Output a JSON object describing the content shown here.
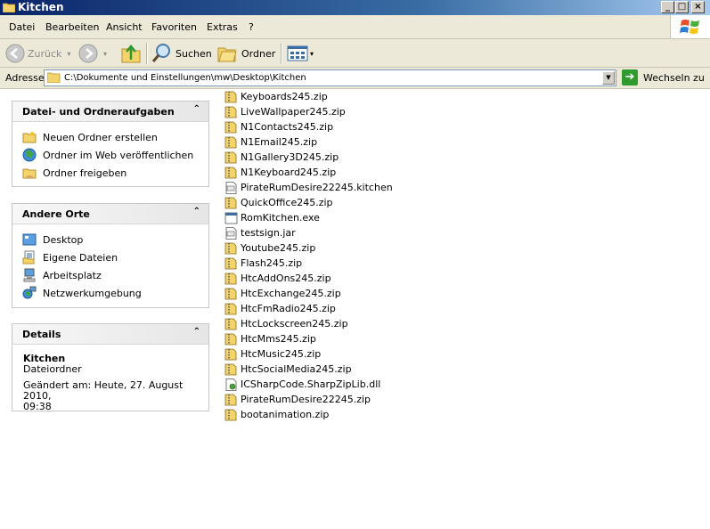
{
  "window": {
    "title": "Kitchen"
  },
  "menu": [
    "Datei",
    "Bearbeiten",
    "Ansicht",
    "Favoriten",
    "Extras",
    "?"
  ],
  "toolbar": {
    "back": "Zurück",
    "search": "Suchen",
    "folders": "Ordner"
  },
  "address": {
    "label": "Adresse",
    "path": "C:\\Dokumente und Einstellungen\\mw\\Desktop\\Kitchen",
    "go": "Wechseln zu"
  },
  "tasks": {
    "title": "Datei- und Ordneraufgaben",
    "items": [
      "Neuen Ordner erstellen",
      "Ordner im Web veröffentlichen",
      "Ordner freigeben"
    ]
  },
  "places": {
    "title": "Andere Orte",
    "items": [
      "Desktop",
      "Eigene Dateien",
      "Arbeitsplatz",
      "Netzwerkumgebung"
    ]
  },
  "details": {
    "title": "Details",
    "name": "Kitchen",
    "type": "Dateiordner",
    "modified": "Geändert am: Heute, 27. August 2010,",
    "modified_time": "09:38"
  },
  "files": [
    {
      "name": "Keyboards245.zip",
      "icon": "zip-icon"
    },
    {
      "name": "LiveWallpaper245.zip",
      "icon": "zip-icon"
    },
    {
      "name": "N1Contacts245.zip",
      "icon": "zip-icon"
    },
    {
      "name": "N1Email245.zip",
      "icon": "zip-icon"
    },
    {
      "name": "N1Gallery3D245.zip",
      "icon": "zip-icon"
    },
    {
      "name": "N1Keyboard245.zip",
      "icon": "zip-icon"
    },
    {
      "name": "PirateRumDesire22245.kitchen",
      "icon": "generic-file-icon"
    },
    {
      "name": "QuickOffice245.zip",
      "icon": "zip-icon"
    },
    {
      "name": "RomKitchen.exe",
      "icon": "exe-icon"
    },
    {
      "name": "testsign.jar",
      "icon": "generic-file-icon"
    },
    {
      "name": "Youtube245.zip",
      "icon": "zip-icon"
    },
    {
      "name": "Flash245.zip",
      "icon": "zip-icon"
    },
    {
      "name": "HtcAddOns245.zip",
      "icon": "zip-icon"
    },
    {
      "name": "HtcExchange245.zip",
      "icon": "zip-icon"
    },
    {
      "name": "HtcFmRadio245.zip",
      "icon": "zip-icon"
    },
    {
      "name": "HtcLockscreen245.zip",
      "icon": "zip-icon"
    },
    {
      "name": "HtcMms245.zip",
      "icon": "zip-icon"
    },
    {
      "name": "HtcMusic245.zip",
      "icon": "zip-icon"
    },
    {
      "name": "HtcSocialMedia245.zip",
      "icon": "zip-icon"
    },
    {
      "name": "ICSharpCode.SharpZipLib.dll",
      "icon": "dll-icon"
    },
    {
      "name": "PirateRumDesire22245.zip",
      "icon": "zip-icon"
    },
    {
      "name": "bootanimation.zip",
      "icon": "zip-icon"
    }
  ]
}
